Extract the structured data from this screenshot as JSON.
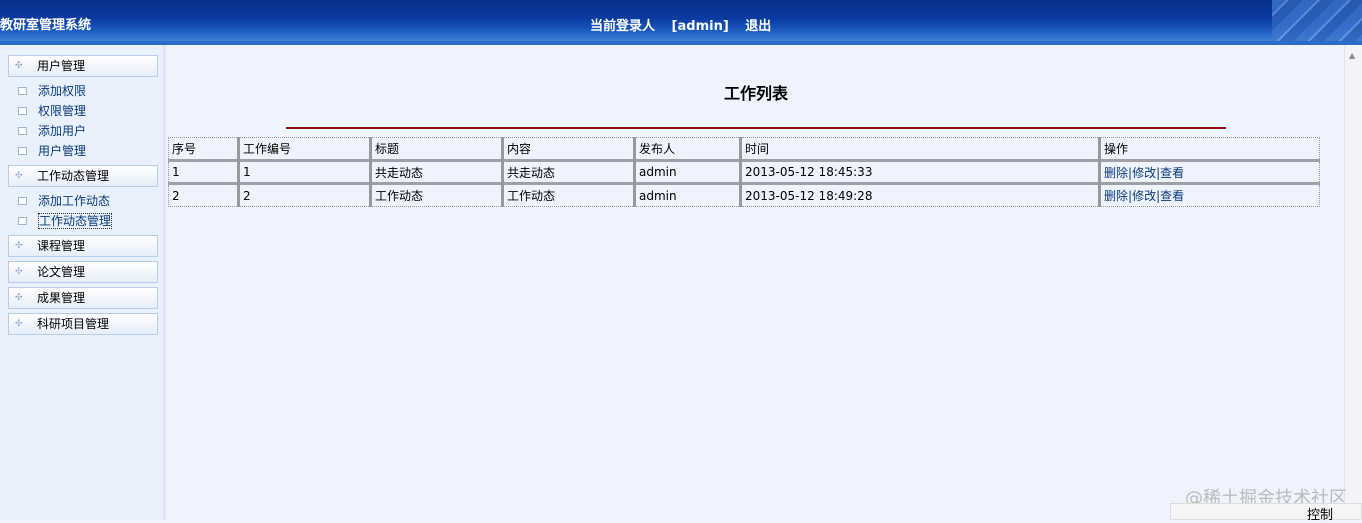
{
  "header": {
    "title": "教研室管理系统",
    "login_label": "当前登录人",
    "user": "[admin]",
    "logout": "退出"
  },
  "sidebar": {
    "groups": [
      {
        "label": "用户管理",
        "items": [
          "添加权限",
          "权限管理",
          "添加用户",
          "用户管理"
        ]
      },
      {
        "label": "工作动态管理",
        "items": [
          "添加工作动态",
          "工作动态管理"
        ]
      },
      {
        "label": "课程管理",
        "items": []
      },
      {
        "label": "论文管理",
        "items": []
      },
      {
        "label": "成果管理",
        "items": []
      },
      {
        "label": "科研项目管理",
        "items": []
      }
    ]
  },
  "main": {
    "title": "工作列表",
    "columns": [
      "序号",
      "工作编号",
      "标题",
      "内容",
      "发布人",
      "时间",
      "操作"
    ],
    "rows": [
      [
        "1",
        "1",
        "共走动态",
        "共走动态",
        "admin",
        "2013-05-12 18:45:33"
      ],
      [
        "2",
        "2",
        "工作动态",
        "工作动态",
        "admin",
        "2013-05-12 18:49:28"
      ]
    ],
    "actions": [
      "删除",
      "修改",
      "查看"
    ],
    "action_sep": "|"
  },
  "watermark": "@稀土掘金技术社区",
  "control": "控制"
}
